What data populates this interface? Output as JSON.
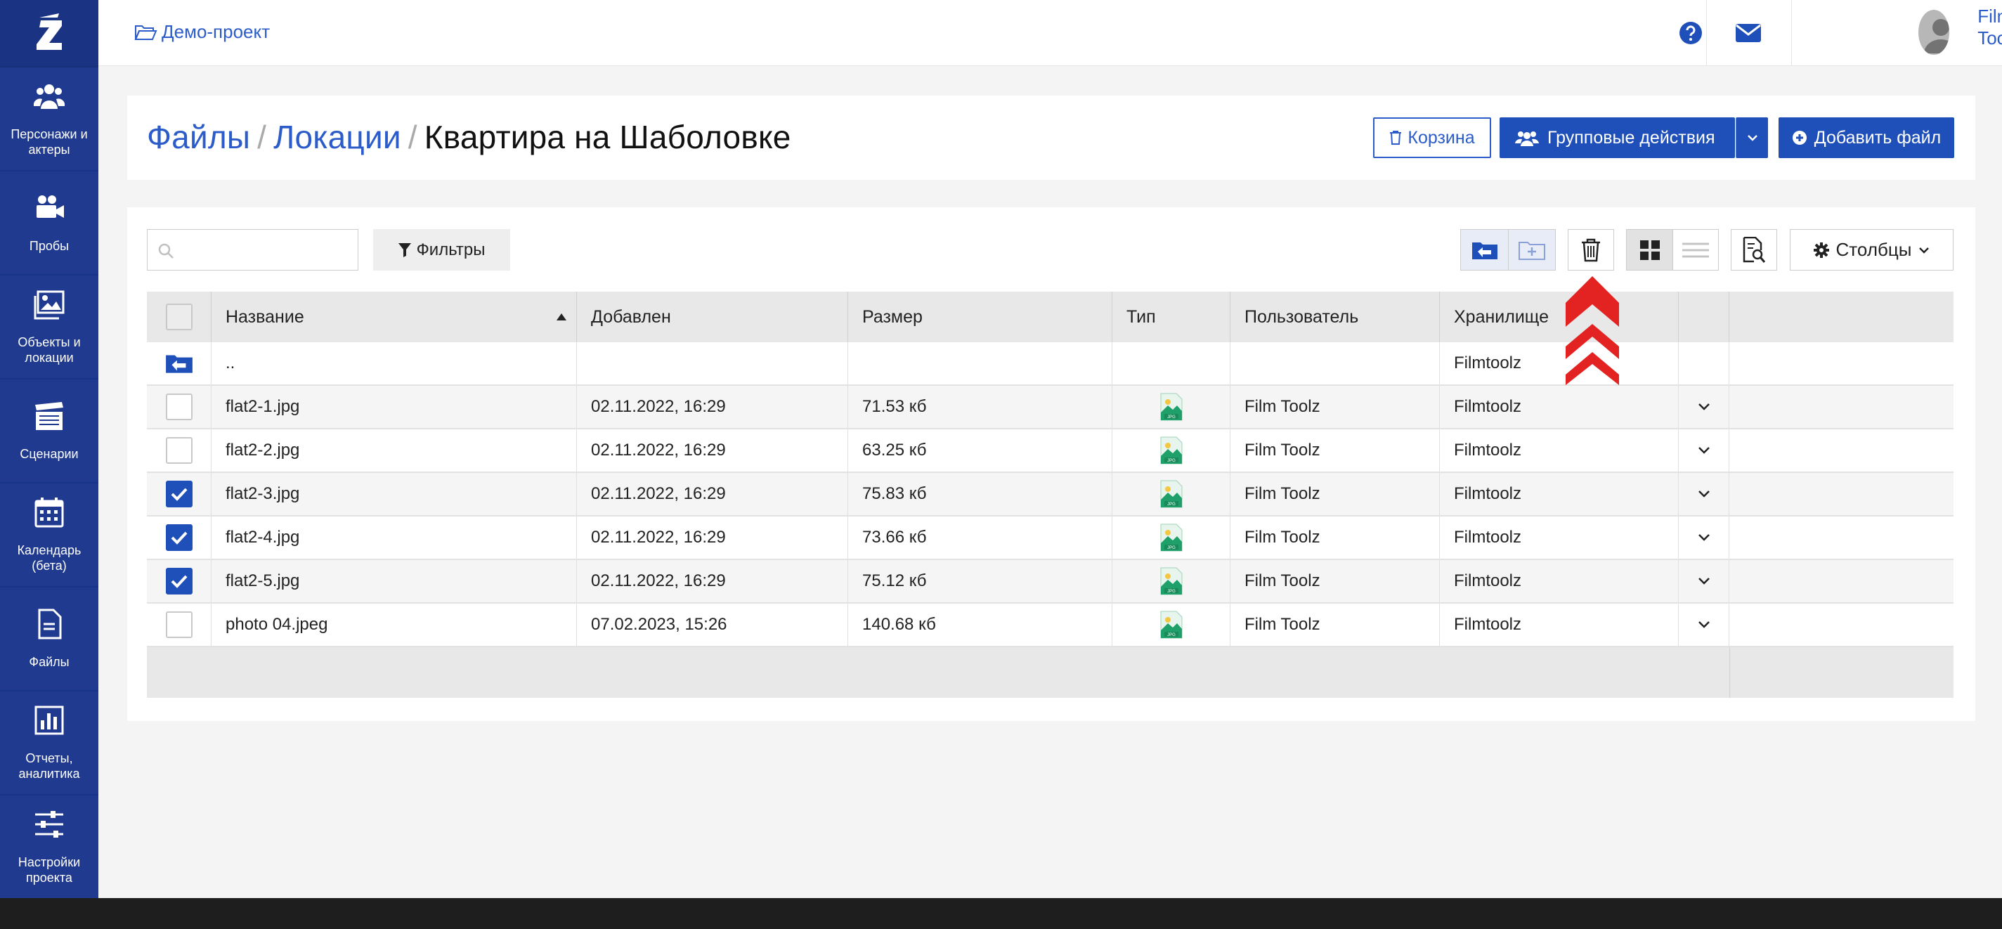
{
  "sidebar": {
    "items": [
      {
        "label": "Персонажи и актеры",
        "icon": "people-icon"
      },
      {
        "label": "Пробы",
        "icon": "video-camera-icon"
      },
      {
        "label": "Объекты и локации",
        "icon": "images-icon"
      },
      {
        "label": "Сценарии",
        "icon": "clapperboard-icon"
      },
      {
        "label": "Календарь (бета)",
        "icon": "calendar-icon"
      },
      {
        "label": "Файлы",
        "icon": "file-icon"
      },
      {
        "label": "Отчеты, аналитика",
        "icon": "chart-icon"
      },
      {
        "label": "Настройки проекта",
        "icon": "sliders-icon"
      }
    ]
  },
  "topbar": {
    "project": "Демо-проект",
    "user_name": "Film Toolz"
  },
  "breadcrumb": {
    "level1": "Файлы",
    "level2": "Локации",
    "current": "Квартира на Шаболовке",
    "separator": "/"
  },
  "header_buttons": {
    "trash": "Корзина",
    "group_actions": "Групповые действия",
    "add_file": "Добавить файл"
  },
  "toolbar": {
    "search_placeholder": "",
    "filters": "Фильтры",
    "columns": "Столбцы"
  },
  "table": {
    "columns": [
      "Название",
      "Добавлен",
      "Размер",
      "Тип",
      "Пользователь",
      "Хранилище"
    ],
    "sort": {
      "column": "Название",
      "direction": "asc"
    },
    "parent_row": {
      "name": "..",
      "storage": "Filmtoolz"
    },
    "rows": [
      {
        "name": "flat2-1.jpg",
        "added": "02.11.2022, 16:29",
        "size": "71.53 кб",
        "type": "JPG",
        "user": "Film Toolz",
        "storage": "Filmtoolz",
        "checked": false
      },
      {
        "name": "flat2-2.jpg",
        "added": "02.11.2022, 16:29",
        "size": "63.25 кб",
        "type": "JPG",
        "user": "Film Toolz",
        "storage": "Filmtoolz",
        "checked": false
      },
      {
        "name": "flat2-3.jpg",
        "added": "02.11.2022, 16:29",
        "size": "75.83 кб",
        "type": "JPG",
        "user": "Film Toolz",
        "storage": "Filmtoolz",
        "checked": true
      },
      {
        "name": "flat2-4.jpg",
        "added": "02.11.2022, 16:29",
        "size": "73.66 кб",
        "type": "JPG",
        "user": "Film Toolz",
        "storage": "Filmtoolz",
        "checked": true
      },
      {
        "name": "flat2-5.jpg",
        "added": "02.11.2022, 16:29",
        "size": "75.12 кб",
        "type": "JPG",
        "user": "Film Toolz",
        "storage": "Filmtoolz",
        "checked": true
      },
      {
        "name": "photo 04.jpeg",
        "added": "07.02.2023, 15:26",
        "size": "140.68 кб",
        "type": "JPG",
        "user": "Film Toolz",
        "storage": "Filmtoolz",
        "checked": false
      }
    ]
  },
  "colors": {
    "sidebar": "#1f3a8f",
    "accent": "#1f4fb8",
    "link": "#2c5cc9",
    "highlight_arrow": "#e32222"
  }
}
